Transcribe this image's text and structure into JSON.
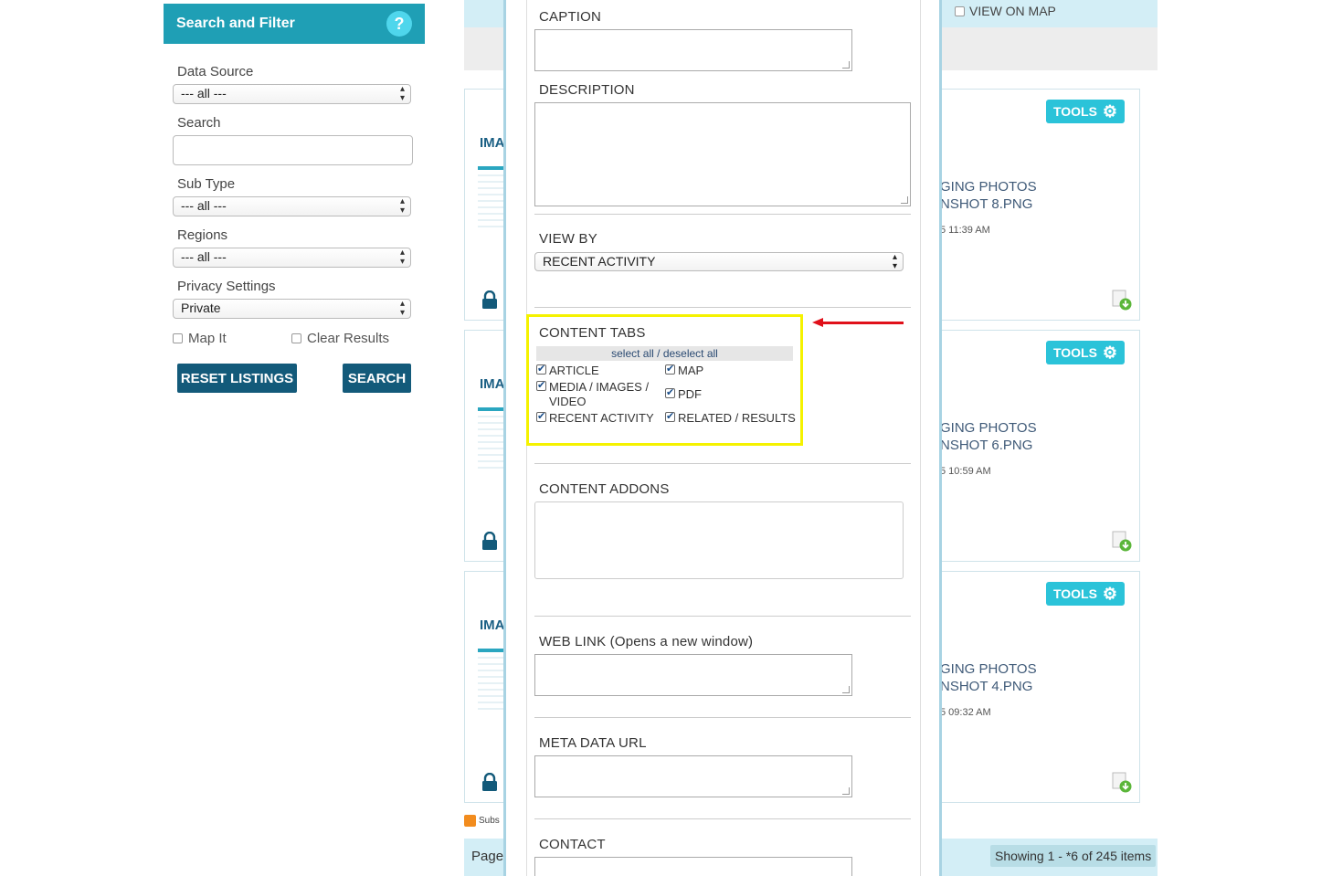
{
  "sidebar": {
    "title": "Search and Filter",
    "help": "?",
    "data_source": {
      "label": "Data Source",
      "value": "--- all ---"
    },
    "search": {
      "label": "Search",
      "value": ""
    },
    "sub_type": {
      "label": "Sub Type",
      "value": "--- all ---"
    },
    "regions": {
      "label": "Regions",
      "value": "--- all ---"
    },
    "privacy": {
      "label": "Privacy Settings",
      "value": "Private"
    },
    "map_it": "Map It",
    "clear_results": "Clear Results",
    "reset_button": "RESET LISTINGS",
    "search_button": "SEARCH"
  },
  "listing": {
    "view_on_map": "VIEW ON MAP",
    "cards": [
      {
        "ima": "IMA",
        "tools": "TOOLS",
        "title1": "GING PHOTOS",
        "title2": "NSHOT 8.PNG",
        "time": "5 11:39 AM"
      },
      {
        "ima": "IMA",
        "tools": "TOOLS",
        "title1": "GING PHOTOS",
        "title2": "NSHOT 6.PNG",
        "time": "5 10:59 AM"
      },
      {
        "ima": "IMA",
        "tools": "TOOLS",
        "title1": "GING PHOTOS",
        "title2": "NSHOT 4.PNG",
        "time": "5 09:32 AM"
      }
    ],
    "subscribe": "Subs",
    "page_label": "Page",
    "showing": "Showing 1 - *6 of 245 items"
  },
  "modal": {
    "caption": "CAPTION",
    "description": "DESCRIPTION",
    "view_by": {
      "label": "VIEW BY",
      "value": "RECENT ACTIVITY"
    },
    "content_tabs": {
      "label": "CONTENT TABS",
      "select_all": "select all / deselect all",
      "items": [
        "ARTICLE",
        "MAP",
        "MEDIA / IMAGES / VIDEO",
        "PDF",
        "RECENT ACTIVITY",
        "RELATED / RESULTS"
      ]
    },
    "content_addons": "CONTENT ADDONS",
    "web_link": "WEB LINK (Opens a new window)",
    "meta_data_url": "META DATA URL",
    "contact": "CONTACT"
  },
  "colors": {
    "header_teal": "#1f9fb5",
    "button_navy": "#135a7a",
    "tools_cyan": "#2bc3d9",
    "highlight_yellow": "#f5f200",
    "arrow_red": "#e0101a"
  }
}
